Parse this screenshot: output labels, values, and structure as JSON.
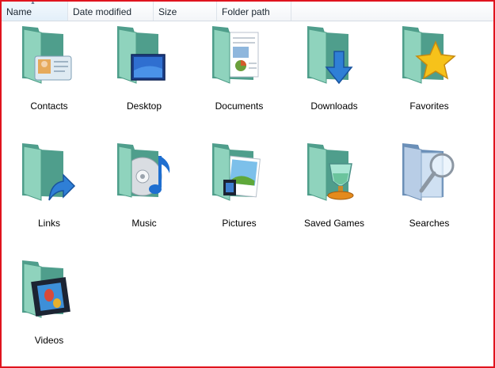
{
  "columns": [
    {
      "label": "Name",
      "sorted": true,
      "sort_direction": "ascending"
    },
    {
      "label": "Date modified"
    },
    {
      "label": "Size"
    },
    {
      "label": "Folder path"
    }
  ],
  "folders": [
    {
      "label": "Contacts",
      "icon": "contacts-folder-icon"
    },
    {
      "label": "Desktop",
      "icon": "desktop-folder-icon"
    },
    {
      "label": "Documents",
      "icon": "documents-folder-icon"
    },
    {
      "label": "Downloads",
      "icon": "downloads-folder-icon"
    },
    {
      "label": "Favorites",
      "icon": "favorites-folder-icon"
    },
    {
      "label": "Links",
      "icon": "links-folder-icon"
    },
    {
      "label": "Music",
      "icon": "music-folder-icon"
    },
    {
      "label": "Pictures",
      "icon": "pictures-folder-icon"
    },
    {
      "label": "Saved Games",
      "icon": "saved-games-folder-icon"
    },
    {
      "label": "Searches",
      "icon": "searches-folder-icon"
    },
    {
      "label": "Videos",
      "icon": "videos-folder-icon"
    }
  ],
  "colors": {
    "frame_border": "#e0141e",
    "folder_teal": "#6fbfa5",
    "accent_blue": "#2f7fd6",
    "star_gold": "#f6c21a"
  }
}
